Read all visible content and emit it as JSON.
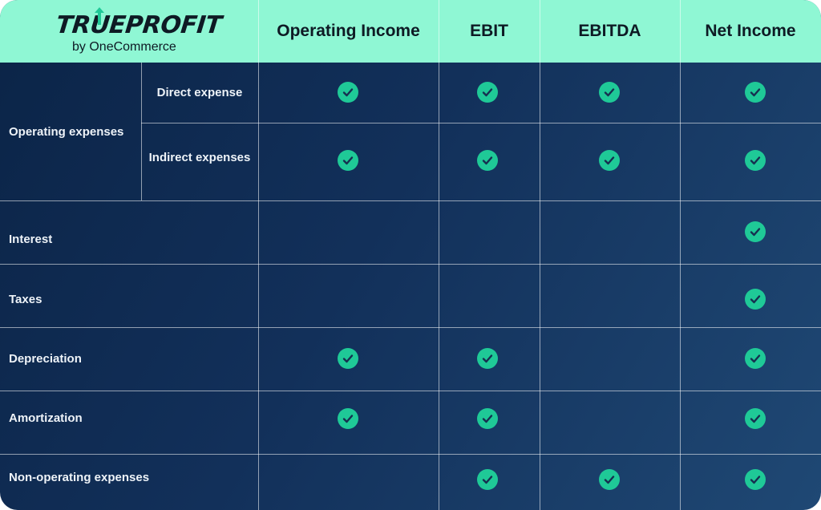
{
  "logo": {
    "brand": "TRUEPROFIT",
    "tagline": "by OneCommerce"
  },
  "columns": [
    "Operating Income",
    "EBIT",
    "EBITDA",
    "Net Income"
  ],
  "group": {
    "label": "Operating expenses",
    "sub_rows": [
      "Direct expense",
      "Indirect expenses"
    ]
  },
  "rows": [
    "Interest",
    "Taxes",
    "Depreciation",
    "Amortization",
    "Non-operating expenses"
  ],
  "matrix": {
    "Direct expense": [
      true,
      true,
      true,
      true
    ],
    "Indirect expenses": [
      true,
      true,
      true,
      true
    ],
    "Interest": [
      false,
      false,
      false,
      true
    ],
    "Taxes": [
      false,
      false,
      false,
      true
    ],
    "Depreciation": [
      true,
      true,
      false,
      true
    ],
    "Amortization": [
      true,
      true,
      false,
      true
    ],
    "Non-operating expenses": [
      false,
      true,
      true,
      true
    ]
  },
  "colors": {
    "header_bg": "#8ff7d4",
    "check": "#1fc997",
    "body_dark": "#0b2447",
    "body_light": "#1f4874"
  }
}
